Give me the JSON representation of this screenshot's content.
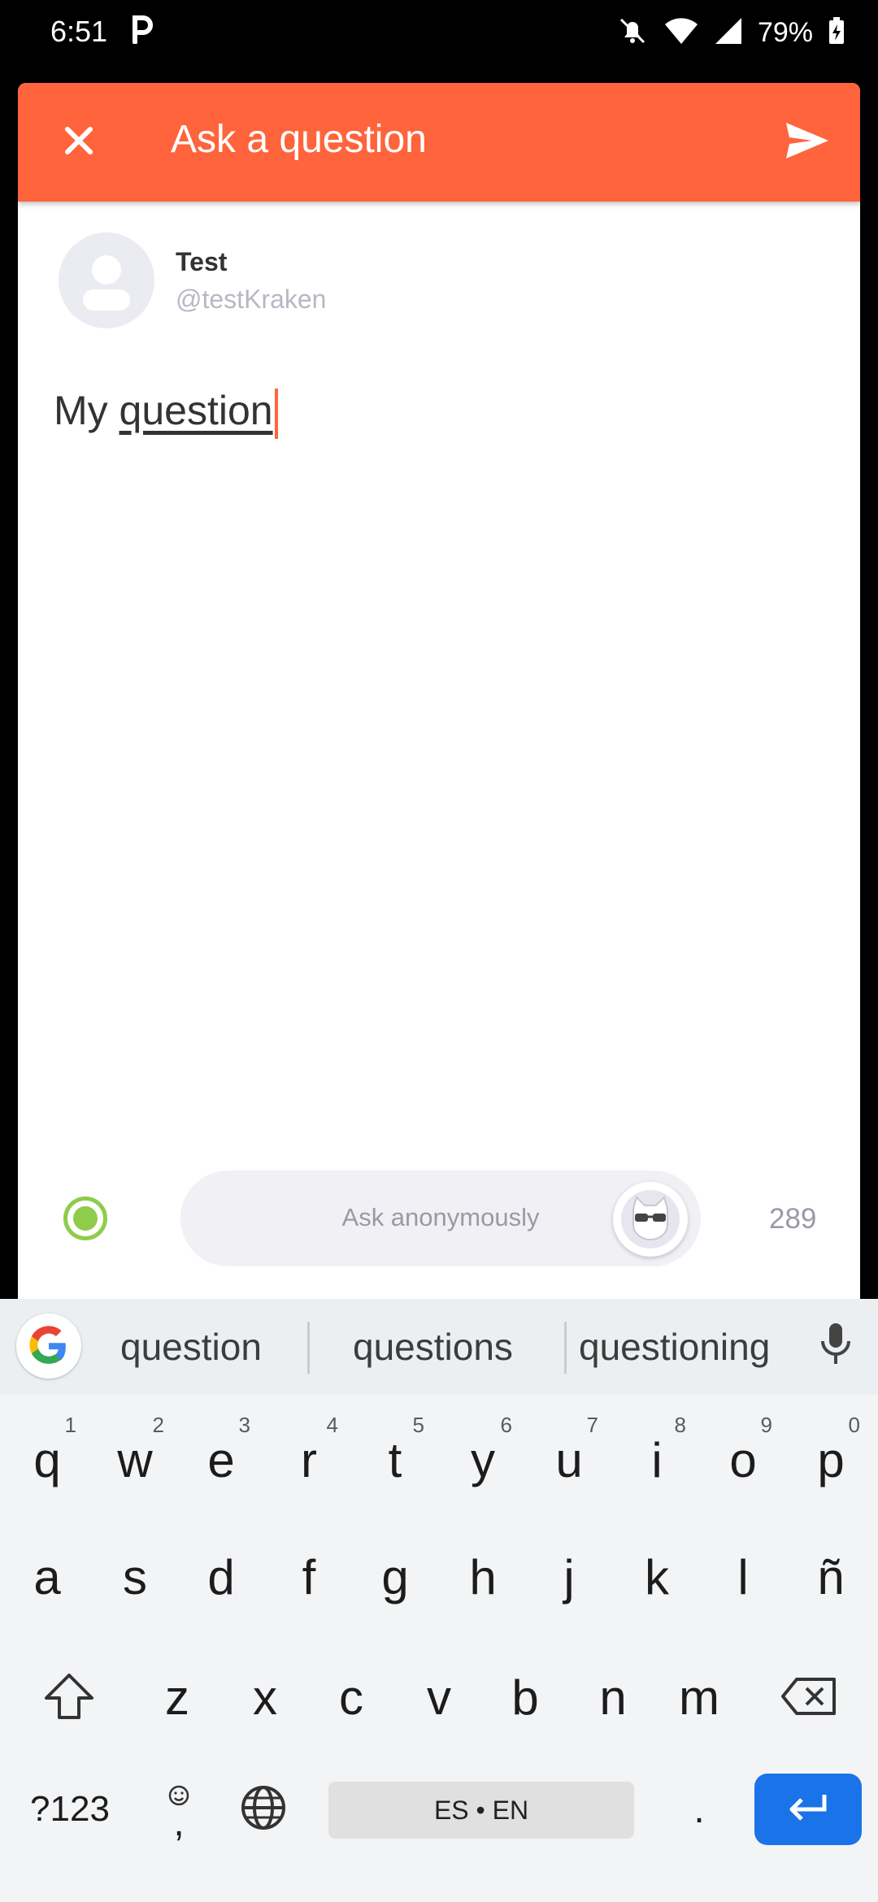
{
  "status_bar": {
    "time": "6:51",
    "battery": "79%"
  },
  "header": {
    "title": "Ask a question"
  },
  "user": {
    "name": "Test",
    "handle": "@testKraken"
  },
  "question": {
    "prefix": "My ",
    "underlined": "question"
  },
  "anonymous": {
    "label": "Ask anonymously",
    "char_count": "289"
  },
  "keyboard": {
    "suggestions": [
      "question",
      "questions",
      "questioning"
    ],
    "row1": [
      {
        "key": "q",
        "hint": "1"
      },
      {
        "key": "w",
        "hint": "2"
      },
      {
        "key": "e",
        "hint": "3"
      },
      {
        "key": "r",
        "hint": "4"
      },
      {
        "key": "t",
        "hint": "5"
      },
      {
        "key": "y",
        "hint": "6"
      },
      {
        "key": "u",
        "hint": "7"
      },
      {
        "key": "i",
        "hint": "8"
      },
      {
        "key": "o",
        "hint": "9"
      },
      {
        "key": "p",
        "hint": "0"
      }
    ],
    "row2": [
      "a",
      "s",
      "d",
      "f",
      "g",
      "h",
      "j",
      "k",
      "l",
      "ñ"
    ],
    "row3": [
      "z",
      "x",
      "c",
      "v",
      "b",
      "n",
      "m"
    ],
    "symbols_label": "?123",
    "comma": ",",
    "space_label": "ES • EN",
    "period": "."
  },
  "colors": {
    "accent": "#ff643c",
    "toggle_green": "#8fcc4b",
    "enter_blue": "#1a73e8"
  }
}
